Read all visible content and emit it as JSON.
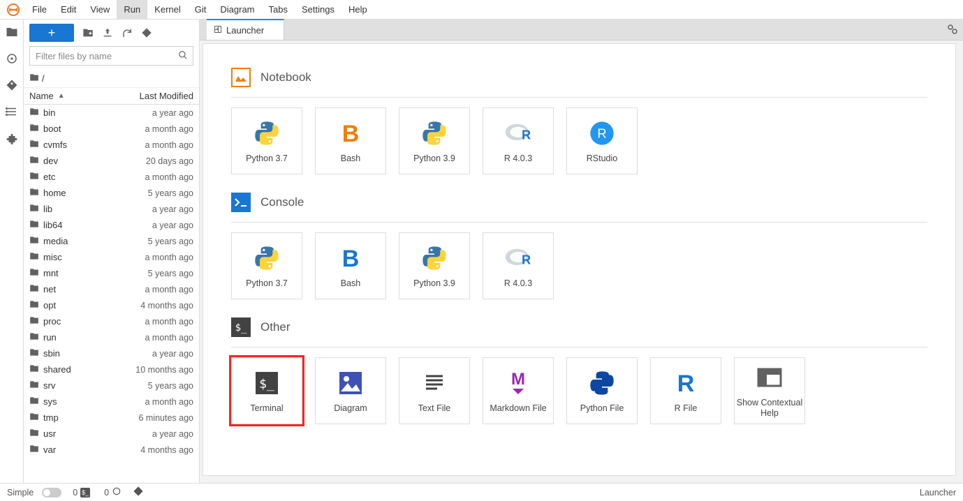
{
  "menubar": {
    "items": [
      "File",
      "Edit",
      "View",
      "Run",
      "Kernel",
      "Git",
      "Diagram",
      "Tabs",
      "Settings",
      "Help"
    ],
    "active_index": 3
  },
  "sidebar": {
    "filter_placeholder": "Filter files by name",
    "breadcrumb_path": "/",
    "columns": {
      "name": "Name",
      "modified": "Last Modified"
    },
    "files": [
      {
        "name": "bin",
        "modified": "a year ago"
      },
      {
        "name": "boot",
        "modified": "a month ago"
      },
      {
        "name": "cvmfs",
        "modified": "a month ago"
      },
      {
        "name": "dev",
        "modified": "20 days ago"
      },
      {
        "name": "etc",
        "modified": "a month ago"
      },
      {
        "name": "home",
        "modified": "5 years ago"
      },
      {
        "name": "lib",
        "modified": "a year ago"
      },
      {
        "name": "lib64",
        "modified": "a year ago"
      },
      {
        "name": "media",
        "modified": "5 years ago"
      },
      {
        "name": "misc",
        "modified": "a month ago"
      },
      {
        "name": "mnt",
        "modified": "5 years ago"
      },
      {
        "name": "net",
        "modified": "a month ago"
      },
      {
        "name": "opt",
        "modified": "4 months ago"
      },
      {
        "name": "proc",
        "modified": "a month ago"
      },
      {
        "name": "run",
        "modified": "a month ago"
      },
      {
        "name": "sbin",
        "modified": "a year ago"
      },
      {
        "name": "shared",
        "modified": "10 months ago"
      },
      {
        "name": "srv",
        "modified": "5 years ago"
      },
      {
        "name": "sys",
        "modified": "a month ago"
      },
      {
        "name": "tmp",
        "modified": "6 minutes ago"
      },
      {
        "name": "usr",
        "modified": "a year ago"
      },
      {
        "name": "var",
        "modified": "4 months ago"
      }
    ]
  },
  "tab": {
    "label": "Launcher"
  },
  "launcher": {
    "sections": [
      {
        "title": "Notebook",
        "icon": "notebook",
        "cards": [
          {
            "label": "Python 3.7",
            "icon": "python"
          },
          {
            "label": "Bash",
            "icon": "bash-orange"
          },
          {
            "label": "Python 3.9",
            "icon": "python"
          },
          {
            "label": "R 4.0.3",
            "icon": "r-lang"
          },
          {
            "label": "RStudio",
            "icon": "rstudio"
          }
        ]
      },
      {
        "title": "Console",
        "icon": "console",
        "cards": [
          {
            "label": "Python 3.7",
            "icon": "python"
          },
          {
            "label": "Bash",
            "icon": "bash-blue"
          },
          {
            "label": "Python 3.9",
            "icon": "python"
          },
          {
            "label": "R 4.0.3",
            "icon": "r-lang"
          }
        ]
      },
      {
        "title": "Other",
        "icon": "terminal-badge",
        "cards": [
          {
            "label": "Terminal",
            "icon": "terminal",
            "highlight": true
          },
          {
            "label": "Diagram",
            "icon": "diagram"
          },
          {
            "label": "Text File",
            "icon": "textfile"
          },
          {
            "label": "Markdown File",
            "icon": "markdown"
          },
          {
            "label": "Python File",
            "icon": "python-dark"
          },
          {
            "label": "R File",
            "icon": "r-blue"
          },
          {
            "label": "Show Contextual Help",
            "icon": "help-panel"
          }
        ]
      }
    ]
  },
  "statusbar": {
    "mode_label": "Simple",
    "left_count": "0",
    "term_count": "0",
    "right_label": "Launcher"
  }
}
